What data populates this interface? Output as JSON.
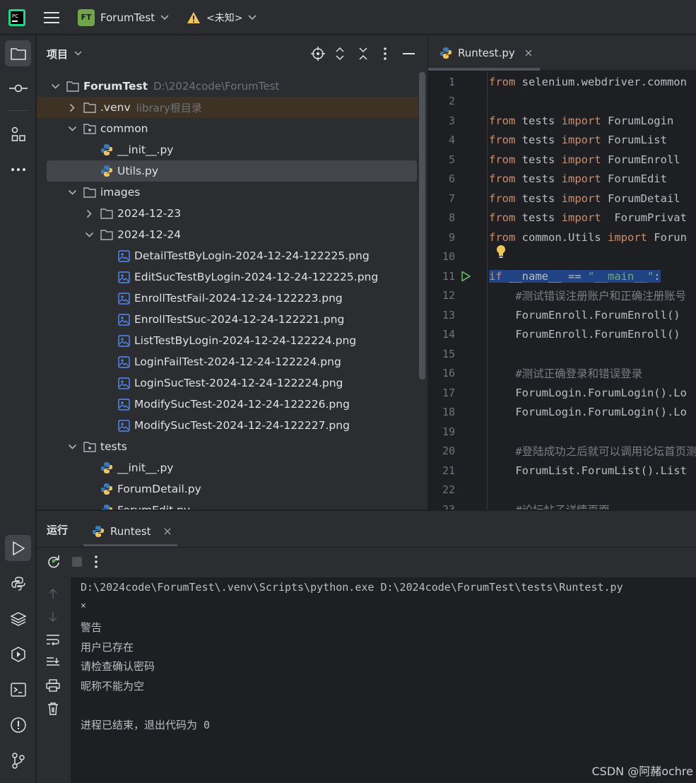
{
  "titlebar": {
    "project_badge": "FT",
    "project_name": "ForumTest",
    "warning_label": "<未知>"
  },
  "project_panel": {
    "title": "项目",
    "tree": [
      {
        "label": "ForumTest",
        "hint": "D:\\2024code\\ForumTest",
        "level": 0,
        "type": "folder",
        "expanded": true,
        "bold": true
      },
      {
        "label": ".venv",
        "hint": "library根目录",
        "level": 1,
        "type": "folder",
        "expanded": false
      },
      {
        "label": "common",
        "hint": "",
        "level": 1,
        "type": "package",
        "expanded": true
      },
      {
        "label": "__init__.py",
        "hint": "",
        "level": 2,
        "type": "python"
      },
      {
        "label": "Utils.py",
        "hint": "",
        "level": 2,
        "type": "python",
        "selected": true
      },
      {
        "label": "images",
        "hint": "",
        "level": 1,
        "type": "folder",
        "expanded": true
      },
      {
        "label": "2024-12-23",
        "hint": "",
        "level": 2,
        "type": "folder",
        "expanded": false
      },
      {
        "label": "2024-12-24",
        "hint": "",
        "level": 2,
        "type": "folder",
        "expanded": true
      },
      {
        "label": "DetailTestByLogin-2024-12-24-122225.png",
        "hint": "",
        "level": 3,
        "type": "image"
      },
      {
        "label": "EditSucTestByLogin-2024-12-24-122225.png",
        "hint": "",
        "level": 3,
        "type": "image"
      },
      {
        "label": "EnrollTestFail-2024-12-24-122223.png",
        "hint": "",
        "level": 3,
        "type": "image"
      },
      {
        "label": "EnrollTestSuc-2024-12-24-122221.png",
        "hint": "",
        "level": 3,
        "type": "image"
      },
      {
        "label": "ListTestByLogin-2024-12-24-122224.png",
        "hint": "",
        "level": 3,
        "type": "image"
      },
      {
        "label": "LoginFailTest-2024-12-24-122224.png",
        "hint": "",
        "level": 3,
        "type": "image"
      },
      {
        "label": "LoginSucTest-2024-12-24-122224.png",
        "hint": "",
        "level": 3,
        "type": "image"
      },
      {
        "label": "ModifySucTest-2024-12-24-122226.png",
        "hint": "",
        "level": 3,
        "type": "image"
      },
      {
        "label": "ModifySucTest-2024-12-24-122227.png",
        "hint": "",
        "level": 3,
        "type": "image"
      },
      {
        "label": "tests",
        "hint": "",
        "level": 1,
        "type": "package",
        "expanded": true
      },
      {
        "label": "__init__.py",
        "hint": "",
        "level": 2,
        "type": "python"
      },
      {
        "label": "ForumDetail.py",
        "hint": "",
        "level": 2,
        "type": "python"
      },
      {
        "label": "ForumEdit.py",
        "hint": "",
        "level": 2,
        "type": "python"
      }
    ]
  },
  "editor": {
    "tab_label": "Runtest.py",
    "lines": [
      {
        "n": "1",
        "parts": [
          [
            "kw",
            "from"
          ],
          [
            "t",
            " selenium.webdriver.common"
          ]
        ]
      },
      {
        "n": "2",
        "parts": []
      },
      {
        "n": "3",
        "parts": [
          [
            "kw",
            "from"
          ],
          [
            "t",
            " tests "
          ],
          [
            "kw",
            "import"
          ],
          [
            "t",
            " ForumLogin"
          ]
        ]
      },
      {
        "n": "4",
        "parts": [
          [
            "kw",
            "from"
          ],
          [
            "t",
            " tests "
          ],
          [
            "kw",
            "import"
          ],
          [
            "t",
            " ForumList"
          ]
        ]
      },
      {
        "n": "5",
        "parts": [
          [
            "kw",
            "from"
          ],
          [
            "t",
            " tests "
          ],
          [
            "kw",
            "import"
          ],
          [
            "t",
            " ForumEnroll"
          ]
        ]
      },
      {
        "n": "6",
        "parts": [
          [
            "kw",
            "from"
          ],
          [
            "t",
            " tests "
          ],
          [
            "kw",
            "import"
          ],
          [
            "t",
            " ForumEdit"
          ]
        ]
      },
      {
        "n": "7",
        "parts": [
          [
            "kw",
            "from"
          ],
          [
            "t",
            " tests "
          ],
          [
            "kw",
            "import"
          ],
          [
            "t",
            " ForumDetail"
          ]
        ]
      },
      {
        "n": "8",
        "parts": [
          [
            "kw",
            "from"
          ],
          [
            "t",
            " tests "
          ],
          [
            "kw",
            "import"
          ],
          [
            "t",
            "  ForumPrivat"
          ]
        ]
      },
      {
        "n": "9",
        "parts": [
          [
            "kw",
            "from"
          ],
          [
            "t",
            " common.Utils "
          ],
          [
            "kw",
            "import"
          ],
          [
            "t",
            " Forun"
          ]
        ]
      },
      {
        "n": "10",
        "parts": []
      },
      {
        "n": "11",
        "parts": [
          [
            "kw",
            "if"
          ],
          [
            "t",
            " __name__ == "
          ],
          [
            "str",
            "\"__main__\""
          ],
          [
            "t",
            ":"
          ]
        ],
        "highlight": true,
        "run": true
      },
      {
        "n": "12",
        "parts": [
          [
            "cmt",
            "    #测试错误注册账户和正确注册账号"
          ]
        ]
      },
      {
        "n": "13",
        "parts": [
          [
            "t",
            "    ForumEnroll.ForumEnroll()"
          ]
        ]
      },
      {
        "n": "14",
        "parts": [
          [
            "t",
            "    ForumEnroll.ForumEnroll()"
          ]
        ]
      },
      {
        "n": "15",
        "parts": []
      },
      {
        "n": "16",
        "parts": [
          [
            "cmt",
            "    #测试正确登录和错误登录"
          ]
        ]
      },
      {
        "n": "17",
        "parts": [
          [
            "t",
            "    ForumLogin.ForumLogin().Lo"
          ]
        ]
      },
      {
        "n": "18",
        "parts": [
          [
            "t",
            "    ForumLogin.ForumLogin().Lo"
          ]
        ]
      },
      {
        "n": "19",
        "parts": []
      },
      {
        "n": "20",
        "parts": [
          [
            "cmt",
            "    #登陆成功之后就可以调用论坛首页测"
          ]
        ]
      },
      {
        "n": "21",
        "parts": [
          [
            "t",
            "    ForumList.ForumList().List"
          ]
        ]
      },
      {
        "n": "22",
        "parts": []
      },
      {
        "n": "23",
        "parts": [
          [
            "cmt",
            "    #论坛帖子详情页面"
          ]
        ]
      }
    ]
  },
  "run_panel": {
    "title": "运行",
    "tab_label": "Runtest",
    "console": [
      "D:\\2024code\\ForumTest\\.venv\\Scripts\\python.exe D:\\2024code\\ForumTest\\tests\\Runtest.py",
      "×",
      "警告",
      "用户已存在",
      "请检查确认密码",
      "昵称不能为空",
      "",
      "进程已结束，退出代码为 0"
    ]
  },
  "watermark": "CSDN @阿赭ochre",
  "colors": {
    "bg_dark": "#1e1f22",
    "panel": "#2b2d30",
    "keyword": "#cf8e6d",
    "string": "#6aab73",
    "comment": "#7a7e85",
    "accent": "#3574f0"
  }
}
